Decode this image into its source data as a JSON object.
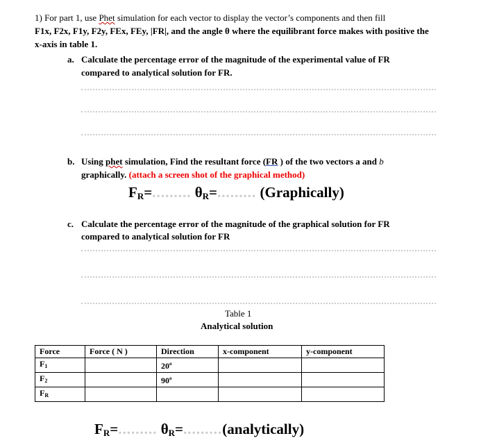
{
  "q1": {
    "line1_a": "1) For part 1, use ",
    "line1_phet": "Phet",
    "line1_b": " simulation for each vector to display the vector’s components and then fill",
    "line2": "F1x, F2x, F1y, F2y, FEx, FEy, |FR|, and the angle θ where the equilibrant force makes with positive the",
    "line3": "x-axis in table 1."
  },
  "a": {
    "marker": "a.",
    "line1": "Calculate the percentage error of the magnitude of the experimental value of FR",
    "line2": "compared to analytical solution for FR."
  },
  "b": {
    "marker": "b.",
    "line1_a": "Using ",
    "line1_phet": "phet",
    "line1_b": " simulation, Find the resultant force (",
    "line1_fr": "FR",
    "line1_c": " ) of the two vectors a and ",
    "line1_var": "b",
    "line2": "graphically.",
    "line2_red": "(attach a screen shot of the graphical method)",
    "result": {
      "fr": "F",
      "fr_sub": "R",
      "eq": "=",
      "fill": ".........",
      "theta": "θ",
      "theta_sub": "R",
      "label": "(Graphically)"
    }
  },
  "c": {
    "marker": "c.",
    "line1": "Calculate the percentage error of the magnitude of the graphical solution for FR",
    "line2": "compared to analytical solution for FR"
  },
  "table": {
    "caption": "Table 1",
    "subtitle": "Analytical solution",
    "headers": [
      "Force",
      "Force ( N )",
      "Direction",
      "x-component",
      "y-component"
    ],
    "rows": [
      {
        "force": "F",
        "sub": "1",
        "direction": "20",
        "deg": "o"
      },
      {
        "force": "F",
        "sub": "2",
        "direction": "90",
        "deg": "o"
      },
      {
        "force": "F",
        "sub": "R",
        "direction": "",
        "deg": ""
      }
    ]
  },
  "result_analytic": {
    "fr": "F",
    "fr_sub": "R",
    "eq": "=",
    "fill": ".........",
    "theta": "θ",
    "theta_sub": "R",
    "label": "(analytically)"
  }
}
